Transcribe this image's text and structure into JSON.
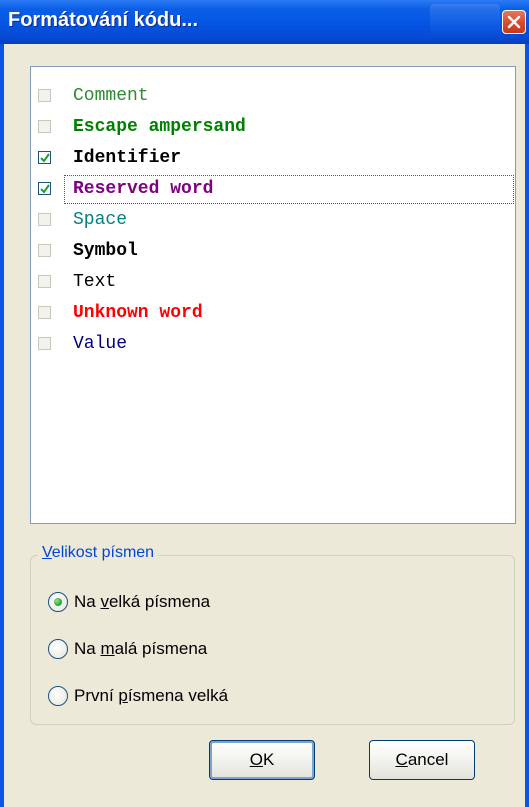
{
  "window": {
    "title": "Formátování kódu..."
  },
  "list": {
    "items": [
      {
        "label": "Comment",
        "checked": false,
        "color": "#2e8b2e",
        "bold": false
      },
      {
        "label": "Escape ampersand",
        "checked": false,
        "color": "#008000",
        "bold": true
      },
      {
        "label": "Identifier",
        "checked": true,
        "color": "#000000",
        "bold": true
      },
      {
        "label": "Reserved word",
        "checked": true,
        "color": "#800080",
        "bold": true,
        "focused": true
      },
      {
        "label": "Space",
        "checked": false,
        "color": "#008080",
        "bold": false
      },
      {
        "label": "Symbol",
        "checked": false,
        "color": "#000000",
        "bold": true
      },
      {
        "label": "Text",
        "checked": false,
        "color": "#000000",
        "bold": false
      },
      {
        "label": "Unknown word",
        "checked": false,
        "color": "#ff0000",
        "bold": true
      },
      {
        "label": "Value",
        "checked": false,
        "color": "#000080",
        "bold": false
      }
    ]
  },
  "case_group": {
    "legend_underlined": "V",
    "legend_rest": "elikost písmen",
    "options": [
      {
        "pre": "Na ",
        "u": "v",
        "post": "elká písmena",
        "checked": true
      },
      {
        "pre": "Na ",
        "u": "m",
        "post": "alá písmena",
        "checked": false
      },
      {
        "pre": "První ",
        "u": "p",
        "post": "ísmena velká",
        "checked": false
      }
    ]
  },
  "buttons": {
    "ok_u": "O",
    "ok_rest": "K",
    "cancel_u": "C",
    "cancel_rest": "ancel"
  },
  "colors": {
    "titlebar": "#0554e3",
    "dialog_bg": "#ece9d8",
    "accent_link": "#0046d5"
  }
}
